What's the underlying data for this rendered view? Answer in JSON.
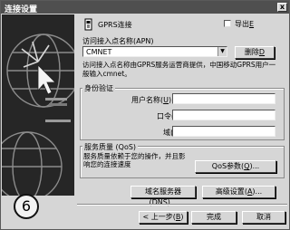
{
  "window": {
    "title": "连接设置",
    "close_glyph": "x"
  },
  "connection_type": "GPRS连接",
  "export": {
    "label": "导出",
    "hotkey": "E",
    "checked": false
  },
  "apn": {
    "label": "访问接入点名称(APN)",
    "value": "CMNET",
    "delete_label": "删除",
    "delete_hotkey": "D",
    "help": "访问接入点名称由GPRS服务运营商提供，中国移动GPRS用户一般输入cmnet。"
  },
  "auth": {
    "title": "身份验证",
    "username_label": "用户名称",
    "username_hotkey": "U",
    "username_value": "",
    "password_label": "口令",
    "password_hotkey": "P",
    "password_value": "",
    "domain_label": "域",
    "domain_hotkey": "D",
    "domain_value": ""
  },
  "qos": {
    "title": "服务质量 (QoS)",
    "description": "服务质量依赖于您的操作，并且影响您的连接速度",
    "button_label": "QoS参数",
    "button_hotkey": "Q"
  },
  "buttons": {
    "dns": "域名服务器(DNS)...",
    "advanced": "高级设置",
    "advanced_hotkey": "A",
    "back": "< 上一步",
    "back_hotkey": "B",
    "finish": "完成",
    "cancel": "取消"
  },
  "step_marker": "6",
  "colors": {
    "titlebar": "#4f4f4f",
    "dialog_bg": "#d6d6d6",
    "art_bg": "#262626"
  }
}
